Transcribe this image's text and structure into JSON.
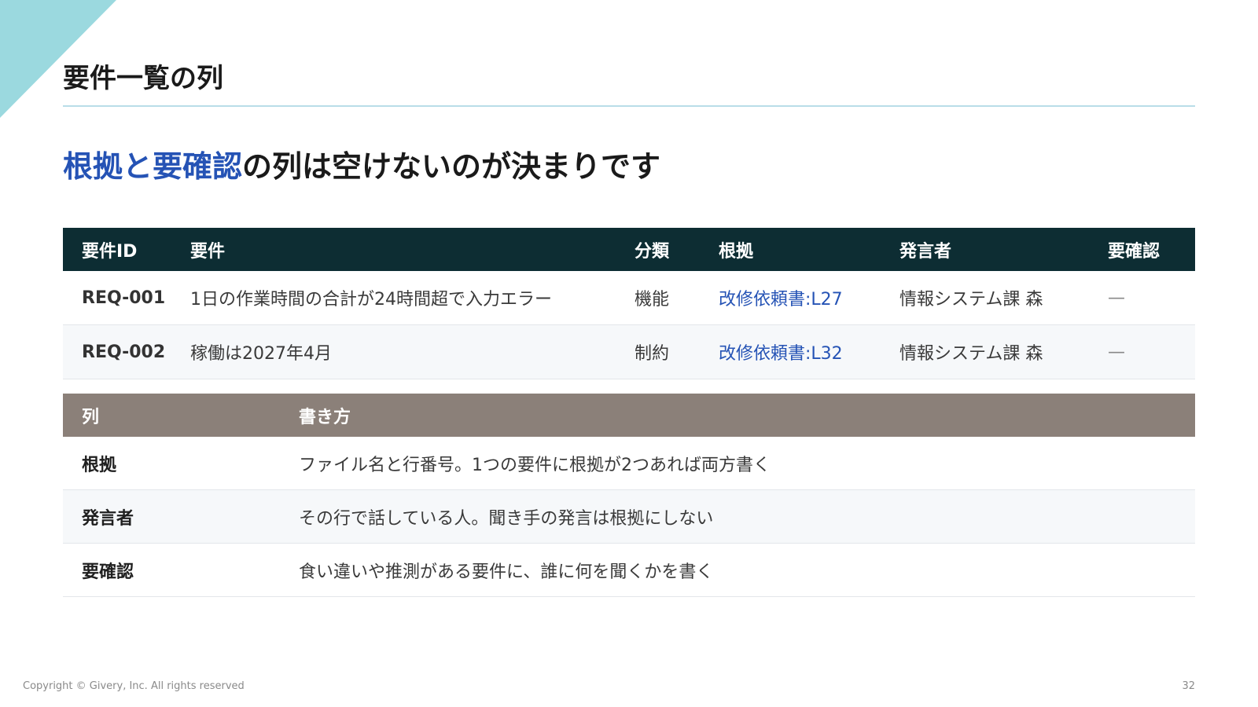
{
  "slide": {
    "title": "要件一覧の列",
    "headline_accent": "根拠と要確認",
    "headline_rest": "の列は空けないのが決まりです",
    "accent_color": "#2553b5",
    "corner_color": "#9bd9df"
  },
  "requirements_table": {
    "headers": [
      "要件ID",
      "要件",
      "分類",
      "根拠",
      "発言者",
      "要確認"
    ],
    "rows": [
      [
        "REQ-001",
        "1日の作業時間の合計が24時間超で入力エラー",
        "機能",
        "改修依頼書:L27",
        "情報システム課 森",
        "—"
      ],
      [
        "REQ-002",
        "稼働は2027年4月",
        "制約",
        "改修依頼書:L32",
        "情報システム課 森",
        "—"
      ]
    ],
    "header_bg": "#0d2d33"
  },
  "guide_table": {
    "headers": [
      "列",
      "書き方"
    ],
    "rows": [
      [
        "根拠",
        "ファイル名と行番号。1つの要件に根拠が2つあれば両方書く"
      ],
      [
        "発言者",
        "その行で話している人。聞き手の発言は根拠にしない"
      ],
      [
        "要確認",
        "食い違いや推測がある要件に、誰に何を聞くかを書く"
      ]
    ],
    "header_bg": "#8b8079"
  },
  "footer": {
    "copyright": "Copyright © Givery, Inc. All rights reserved",
    "page_number": "32"
  }
}
